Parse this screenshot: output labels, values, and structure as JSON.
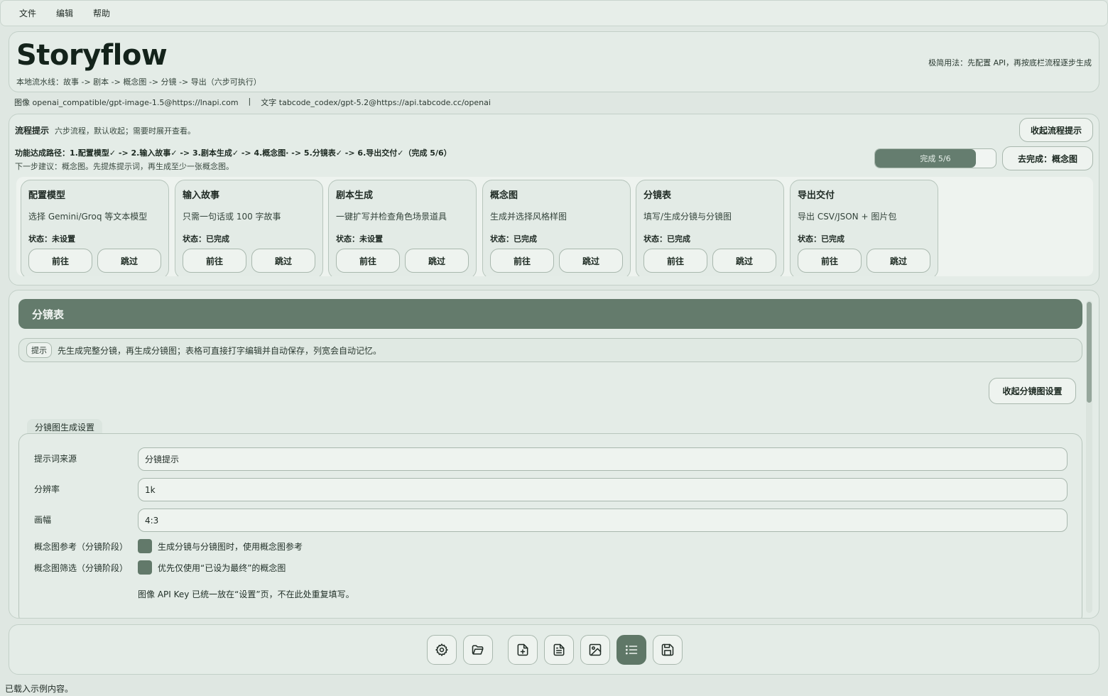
{
  "menu": [
    "文件",
    "编辑",
    "帮助"
  ],
  "header": {
    "title": "Storyflow",
    "subtitle": "本地流水线：故事 -> 剧本 -> 概念图 -> 分镜 -> 导出（六步可执行）",
    "hint": "极简用法：先配置 API，再按底栏流程逐步生成"
  },
  "models": {
    "image": "图像 openai_compatible/gpt-image-1.5@https://lnapi.com",
    "separator": "|",
    "text": "文字 tabcode_codex/gpt-5.2@https://api.tabcode.cc/openai"
  },
  "flow": {
    "title": "流程提示",
    "desc": "六步流程，默认收起；需要时展开查看。",
    "collapse_label": "收起流程提示",
    "path": "功能达成路径：1.配置模型✓ -> 2.输入故事✓ -> 3.剧本生成✓ -> 4.概念图· -> 5.分镜表✓ -> 6.导出交付✓（完成 5/6）",
    "next": "下一步建议：概念图。先提炼提示词，再生成至少一张概念图。",
    "progress_label": "完成 5/6",
    "progress_fraction": 0.833,
    "goto_label": "去完成：概念图",
    "cards": [
      {
        "title": "配置模型",
        "desc": "选择 Gemini/Groq 等文本模型",
        "status": "状态：未设置",
        "go": "前往",
        "skip": "跳过"
      },
      {
        "title": "输入故事",
        "desc": "只需一句话或 100 字故事",
        "status": "状态：已完成",
        "go": "前往",
        "skip": "跳过"
      },
      {
        "title": "剧本生成",
        "desc": "一键扩写并检查角色场景道具",
        "status": "状态：未设置",
        "go": "前往",
        "skip": "跳过"
      },
      {
        "title": "概念图",
        "desc": "生成并选择风格样图",
        "status": "状态：已完成",
        "go": "前往",
        "skip": "跳过"
      },
      {
        "title": "分镜表",
        "desc": "填写/生成分镜与分镜图",
        "status": "状态：已完成",
        "go": "前往",
        "skip": "跳过"
      },
      {
        "title": "导出交付",
        "desc": "导出 CSV/JSON + 图片包",
        "status": "状态：已完成",
        "go": "前往",
        "skip": "跳过"
      }
    ]
  },
  "main": {
    "title": "分镜表",
    "tip_badge": "提示",
    "tip_text": "先生成完整分镜，再生成分镜图；表格可直接打字编辑并自动保存，列宽会自动记忆。",
    "collapse_label": "收起分镜图设置",
    "settings_tab": "分镜图生成设置",
    "fields": [
      {
        "label": "提示词来源",
        "value": "分镜提示"
      },
      {
        "label": "分辨率",
        "value": "1k"
      },
      {
        "label": "画幅",
        "value": "4:3"
      }
    ],
    "checks": [
      {
        "label": "概念图参考（分镜阶段）",
        "text": "生成分镜与分镜图时，使用概念图参考",
        "checked": true
      },
      {
        "label": "概念图筛选（分镜阶段）",
        "text": "优先仅使用“已设为最终”的概念图",
        "checked": true
      }
    ],
    "note": "图像 API Key 已统一放在“设置”页，不在此处重复填写。"
  },
  "toolbar": {
    "icons": [
      "gear-icon",
      "folder-open-icon",
      "file-plus-icon",
      "file-text-icon",
      "image-icon",
      "list-icon",
      "save-icon"
    ],
    "active": "list-icon"
  },
  "status": "已载入示例内容。",
  "colors": {
    "accent": "#647b6c",
    "background": "#dfe7e2"
  }
}
